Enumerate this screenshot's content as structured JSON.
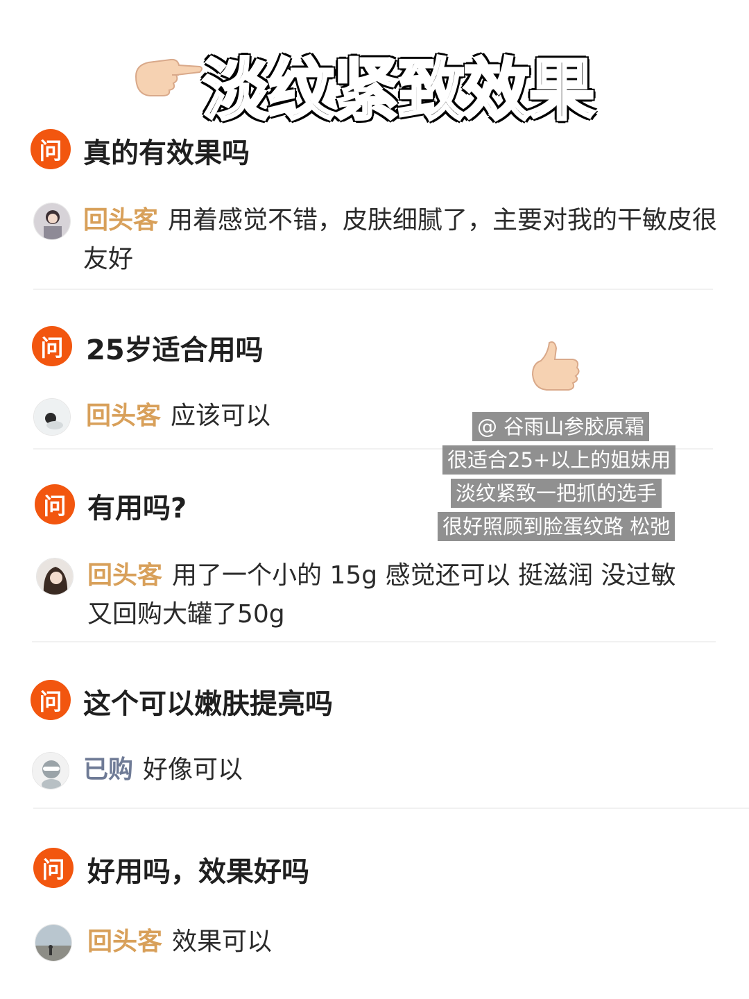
{
  "header": {
    "title": "淡纹紧致效果",
    "icon": "pointing-hand-icon"
  },
  "question_badge": "问",
  "qa": [
    {
      "question": "真的有效果吗",
      "tag": "回头客",
      "answer": "用着感觉不错，皮肤细腻了，主要对我的干敏皮很友好",
      "avatar": "avatar-girl-1"
    },
    {
      "question": "25岁适合用吗",
      "tag": "回头客",
      "answer": "应该可以",
      "avatar": "avatar-girl-2"
    },
    {
      "question": "有用吗?",
      "tag": "回头客",
      "answer": "用了一个小的 15g 感觉还可以 挺滋润 没过敏又回购大罐了50g",
      "avatar": "avatar-girl-3"
    },
    {
      "question": "这个可以嫩肤提亮吗",
      "tag": "已购",
      "answer": "好像可以",
      "avatar": "avatar-default"
    },
    {
      "question": "好用吗，效果好吗",
      "tag": "回头客",
      "answer": "效果可以",
      "avatar": "avatar-beach"
    }
  ],
  "overlay": {
    "icon": "thumbs-up-icon",
    "lines": [
      "@ 谷雨山参胶原霜",
      "很适合25+以上的姐妹用",
      "淡纹紧致一把抓的选手",
      "很好照顾到脸蛋纹路 松弛"
    ]
  },
  "colors": {
    "badge": "#f2560f",
    "tag_returning": "#d8a05a",
    "tag_bought": "#6f7b96"
  }
}
